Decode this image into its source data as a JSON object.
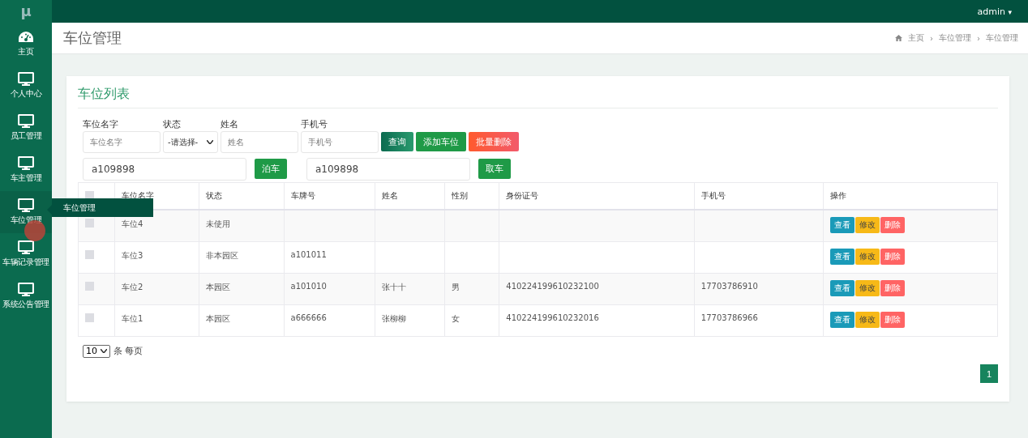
{
  "logo": "μ",
  "user": {
    "name": "admin",
    "caret": "▾"
  },
  "sidebar": {
    "items": [
      {
        "label": "主页",
        "selected": false
      },
      {
        "label": "个人中心",
        "selected": false
      },
      {
        "label": "员工管理",
        "selected": false
      },
      {
        "label": "车主管理",
        "selected": false
      },
      {
        "label": "车位管理",
        "selected": true
      },
      {
        "label": "车辆记录管理",
        "selected": false
      },
      {
        "label": "系统公告管理",
        "selected": false
      }
    ],
    "tooltip": "车位管理"
  },
  "page_title": "车位管理",
  "breadcrumb": [
    "主页",
    "车位管理",
    "车位管理"
  ],
  "breadcrumb_separator": "›",
  "card_title": "车位列表",
  "filters": [
    {
      "kind": "input",
      "label": "车位名字",
      "placeholder": "车位名字"
    },
    {
      "kind": "select",
      "label": "状态",
      "value": "-请选择-"
    },
    {
      "kind": "input",
      "label": "姓名",
      "placeholder": "姓名"
    },
    {
      "kind": "input",
      "label": "手机号",
      "placeholder": "手机号"
    }
  ],
  "filter_buttons": [
    {
      "label": "查询",
      "kind": "search"
    },
    {
      "label": "添加车位",
      "kind": "add"
    },
    {
      "label": "批量删除",
      "kind": "danger"
    }
  ],
  "park_actions": [
    {
      "value": "a109898",
      "button": "泊车"
    },
    {
      "value": "a109898",
      "button": "取车"
    }
  ],
  "table": {
    "all_checked": false,
    "columns": [
      "车位名字",
      "状态",
      "车牌号",
      "姓名",
      "性别",
      "身份证号",
      "手机号",
      "操作"
    ],
    "rows": [
      {
        "checked": false,
        "cells": [
          "车位4",
          "未使用",
          "",
          "",
          "",
          "",
          ""
        ],
        "actions": [
          {
            "label": "查看",
            "kind": "view"
          },
          {
            "label": "修改",
            "kind": "edit"
          },
          {
            "label": "删除",
            "kind": "delete"
          }
        ]
      },
      {
        "checked": false,
        "cells": [
          "车位3",
          "非本园区",
          "a101011",
          "",
          "",
          "",
          ""
        ],
        "actions": [
          {
            "label": "查看",
            "kind": "view"
          },
          {
            "label": "修改",
            "kind": "edit"
          },
          {
            "label": "删除",
            "kind": "delete"
          }
        ]
      },
      {
        "checked": false,
        "cells": [
          "车位2",
          "本园区",
          "a101010",
          "张十十",
          "男",
          "410224199610232100",
          "17703786910"
        ],
        "actions": [
          {
            "label": "查看",
            "kind": "view"
          },
          {
            "label": "修改",
            "kind": "edit"
          },
          {
            "label": "删除",
            "kind": "delete"
          }
        ]
      },
      {
        "checked": false,
        "cells": [
          "车位1",
          "本园区",
          "a666666",
          "张柳柳",
          "女",
          "410224199610232016",
          "17703786966"
        ],
        "actions": [
          {
            "label": "查看",
            "kind": "view"
          },
          {
            "label": "修改",
            "kind": "edit"
          },
          {
            "label": "删除",
            "kind": "delete"
          }
        ]
      }
    ]
  },
  "page_size": {
    "value": "10",
    "label": "条 每页"
  },
  "pagination": [
    {
      "label": "1",
      "selected": true
    }
  ]
}
